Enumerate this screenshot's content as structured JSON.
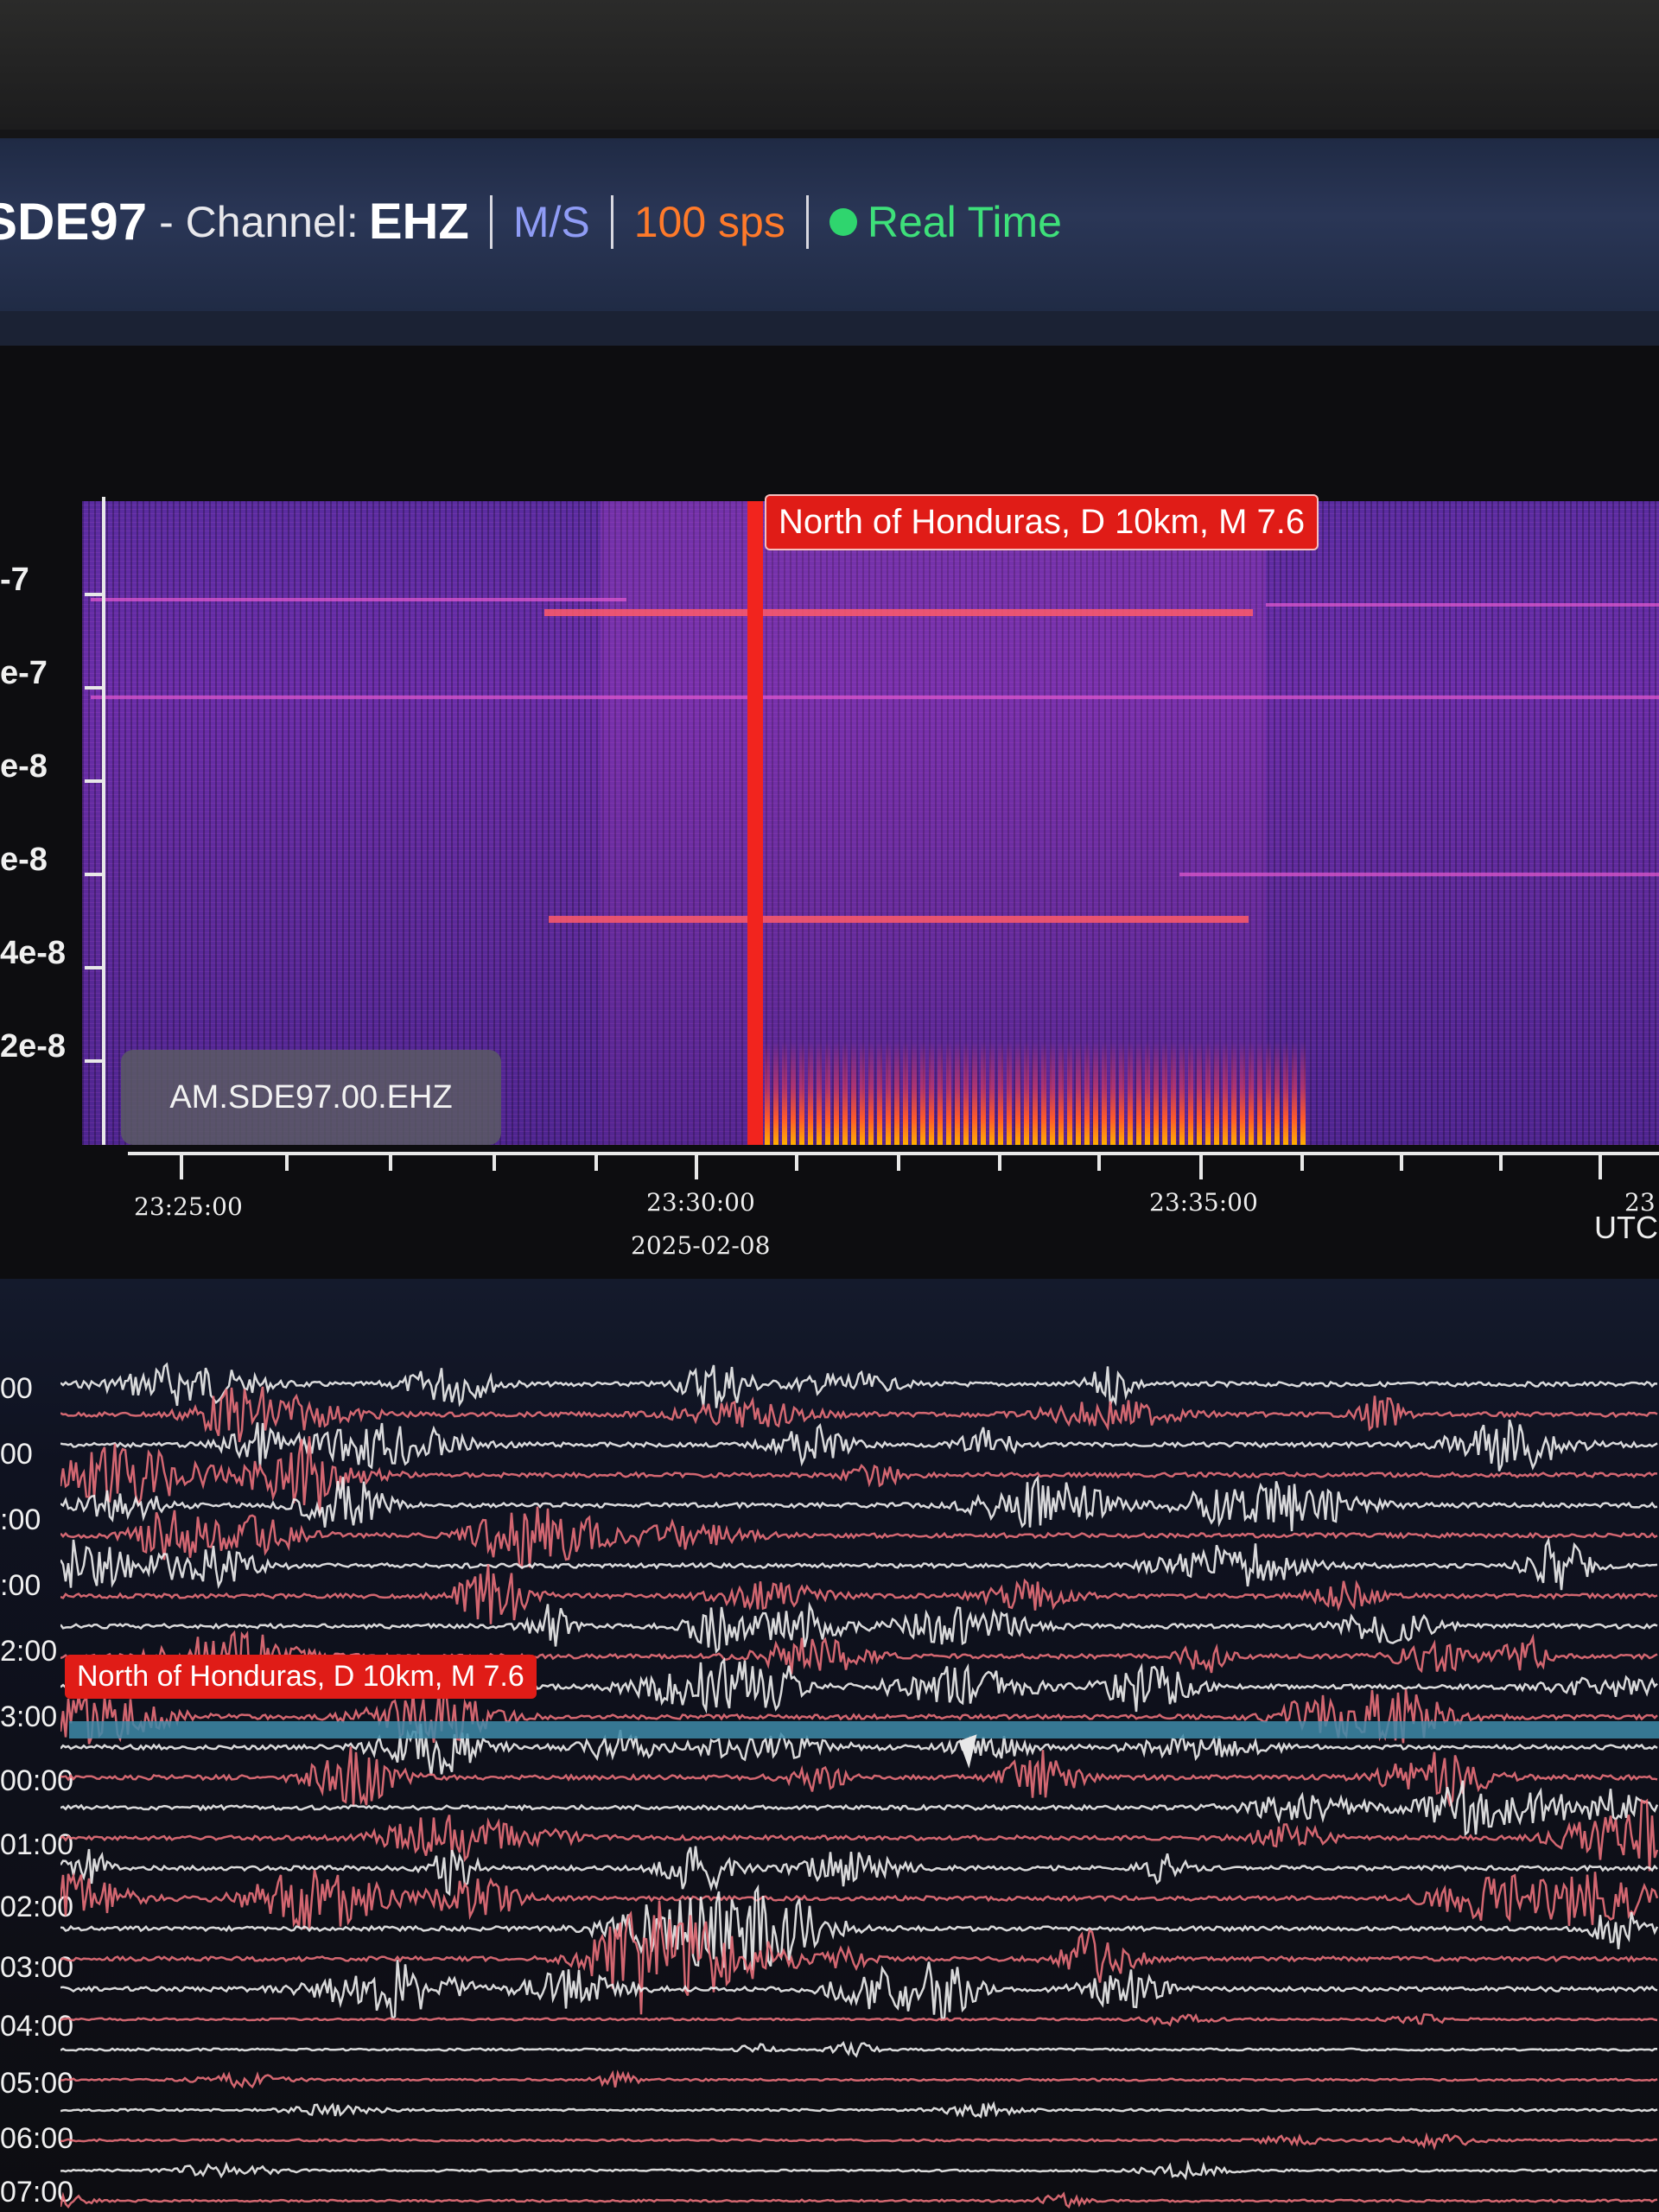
{
  "header": {
    "station": "SDE97",
    "channel_label": "- Channel:",
    "channel": "EHZ",
    "units": "M/S",
    "sample_rate": "100 sps",
    "status": "Real Time"
  },
  "spectrogram": {
    "event_label": "North of Honduras, D 10km, M 7.6",
    "station_badge": "AM.SDE97.00.EHZ",
    "y_ticks": [
      "-7",
      "e-7",
      "e-8",
      "e-8",
      "4e-8",
      "2e-8"
    ],
    "x_ticks": [
      "23:25:00",
      "23:30:00",
      "23:35:00",
      "23"
    ],
    "date_label": "2025-02-08",
    "timezone": "UTC"
  },
  "helicorder": {
    "event_label": "North of Honduras, D 10km, M 7.6",
    "row_labels": [
      "00",
      "00",
      ":00",
      ":00",
      "2:00",
      "3:00",
      "00:00",
      "01:00",
      "02:00",
      "03:00",
      "04:00",
      "05:00",
      "06:00",
      "07:00"
    ]
  },
  "colors": {
    "event": "#e01c17",
    "units": "#8f9cf5",
    "sample_rate": "#ff7a2a",
    "status": "#3ee07a",
    "trace_a": "#f0f0f0",
    "trace_b": "#e8707a"
  }
}
